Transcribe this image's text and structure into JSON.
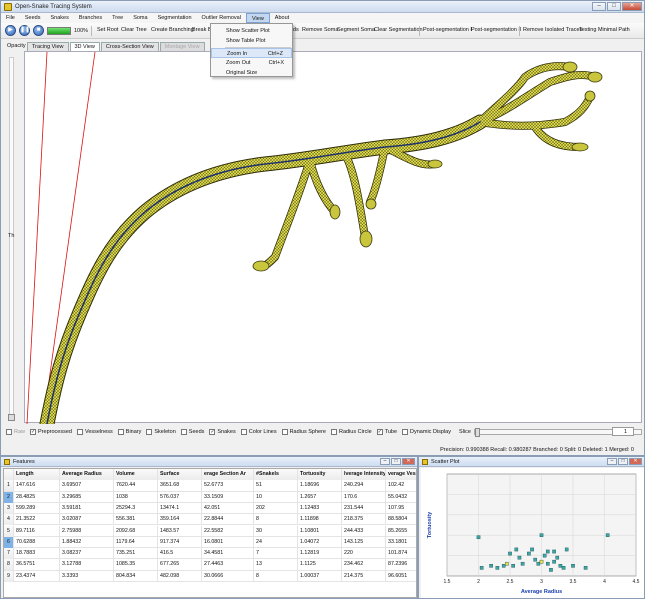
{
  "app": {
    "title": "Open-Snake Tracing System"
  },
  "menu": [
    "File",
    "Seeds",
    "Snakes",
    "Branches",
    "Tree",
    "Soma",
    "Segmentation",
    "Outlier Removal",
    "View",
    "About"
  ],
  "menu_active": "View",
  "toolbar": {
    "progress_value": 1.0,
    "progress_text": "100%",
    "buttons": [
      "Set Root",
      "Clear Tree",
      "Create Branching",
      "Break B",
      "ds",
      "Remove Soma",
      "Segment Soma",
      "Clear Segmentation",
      "Post-segmentation I",
      "Post-segmentation II",
      "Remove Isolated Traces",
      "Testing Minimal Path"
    ]
  },
  "view_menu": {
    "items": [
      {
        "label": "Show Scatter Plot",
        "shortcut": ""
      },
      {
        "label": "Show Table Plot",
        "shortcut": ""
      },
      {
        "label": "Zoom In",
        "shortcut": "Ctrl+Z"
      },
      {
        "label": "Zoom Out",
        "shortcut": "Ctrl+X"
      },
      {
        "label": "Original Size",
        "shortcut": ""
      }
    ]
  },
  "left_panel": {
    "opacity_label": "Opacity",
    "th_label": "Th"
  },
  "tabs": [
    "Tracing View",
    "3D View",
    "Cross-Section View",
    "Montage View"
  ],
  "active_tab": "3D View",
  "options": {
    "items": [
      {
        "label": "Raw",
        "checked": false,
        "enabled": false
      },
      {
        "label": "Preprocessed",
        "checked": true,
        "enabled": true
      },
      {
        "label": "Vesselness",
        "checked": false,
        "enabled": true
      },
      {
        "label": "Binary",
        "checked": false,
        "enabled": true
      },
      {
        "label": "Skeleton",
        "checked": false,
        "enabled": true
      },
      {
        "label": "Seeds",
        "checked": false,
        "enabled": true
      },
      {
        "label": "Snakes",
        "checked": true,
        "enabled": true
      },
      {
        "label": "Color Lines",
        "checked": false,
        "enabled": true
      },
      {
        "label": "Radius Sphere",
        "checked": false,
        "enabled": true
      },
      {
        "label": "Radius Circle",
        "checked": false,
        "enabled": true
      },
      {
        "label": "Tube",
        "checked": true,
        "enabled": true
      },
      {
        "label": "Dynamic Display",
        "checked": false,
        "enabled": true
      }
    ],
    "slice_label": "Slice",
    "slice_value": "1"
  },
  "status": {
    "text": "Precision:  0.990388  Recall:  0.980287  Branched:  0  Split:  0  Deleted:  1  Merged:  0"
  },
  "features_window": {
    "title": "Features",
    "columns": [
      "",
      "Length",
      "Average Radius",
      "Volume",
      "Surface",
      "erage Section Ar",
      "#Snakels",
      "Tortuosity",
      "lverage Intensity",
      "verage Vesselne:"
    ],
    "rows": [
      [
        "1",
        "147.616",
        "3.69507",
        "7620.44",
        "3651.68",
        "52.6773",
        "51",
        "1.18696",
        "240.294",
        "102.42"
      ],
      [
        "2",
        "28.4825",
        "3.29685",
        "1038",
        "576.037",
        "33.1509",
        "10",
        "1.2657",
        "170.6",
        "55.0432"
      ],
      [
        "3",
        "599.289",
        "3.59181",
        "25294.3",
        "13474.1",
        "42.051",
        "202",
        "1.12483",
        "231.544",
        "107.95"
      ],
      [
        "4",
        "21.3522",
        "3.02087",
        "556.381",
        "359.164",
        "22.8844",
        "8",
        "1.11898",
        "218.375",
        "88.5804"
      ],
      [
        "5",
        "89.7116",
        "2.75988",
        "2092.68",
        "1483.57",
        "22.5582",
        "30",
        "1.10801",
        "244.433",
        "85.2655"
      ],
      [
        "6",
        "70.6288",
        "1.88432",
        "1179.64",
        "917.374",
        "16.0801",
        "24",
        "1.04072",
        "143.125",
        "33.1801"
      ],
      [
        "7",
        "18.7883",
        "3.08237",
        "735.251",
        "416.5",
        "34.4581",
        "7",
        "1.12819",
        "220",
        "101.874"
      ],
      [
        "8",
        "36.5751",
        "3.12788",
        "1085.35",
        "677.265",
        "27.4463",
        "13",
        "1.1125",
        "234.462",
        "87.2396"
      ],
      [
        "9",
        "23.4374",
        "3.3393",
        "804.834",
        "482.098",
        "30.0666",
        "8",
        "1.00037",
        "214.375",
        "96.6051"
      ]
    ],
    "selected_rows": [
      1,
      5
    ]
  },
  "scatter_window": {
    "title": "Scatter Plot"
  },
  "chart_data": {
    "type": "scatter",
    "title": "",
    "xlabel": "Average Radius",
    "ylabel": "Tortuosity",
    "xlim": [
      1.5,
      4.5
    ],
    "ylim": [
      1.0,
      1.5
    ],
    "x_ticks": [
      "1.5",
      "2",
      "2.5",
      "3",
      "3.5",
      "4",
      "4.5"
    ],
    "x": [
      2.0,
      2.3,
      2.4,
      2.5,
      2.6,
      2.7,
      2.8,
      2.9,
      2.95,
      3.0,
      3.05,
      3.1,
      3.15,
      3.2,
      3.25,
      3.3,
      3.35,
      3.4,
      3.7,
      4.05,
      2.05,
      2.55,
      2.85,
      3.0,
      3.1,
      3.2,
      2.2,
      2.65,
      3.5,
      2.45
    ],
    "y": [
      1.19,
      1.04,
      1.05,
      1.11,
      1.13,
      1.06,
      1.11,
      1.08,
      1.06,
      1.2,
      1.1,
      1.12,
      1.03,
      1.07,
      1.09,
      1.05,
      1.04,
      1.13,
      1.04,
      1.2,
      1.04,
      1.05,
      1.13,
      1.07,
      1.06,
      1.12,
      1.05,
      1.09,
      1.05,
      1.06
    ],
    "highlighted_indices": [
      23,
      29
    ],
    "point_color": "#3aa8a8",
    "highlight_color": "#e8e24a"
  }
}
